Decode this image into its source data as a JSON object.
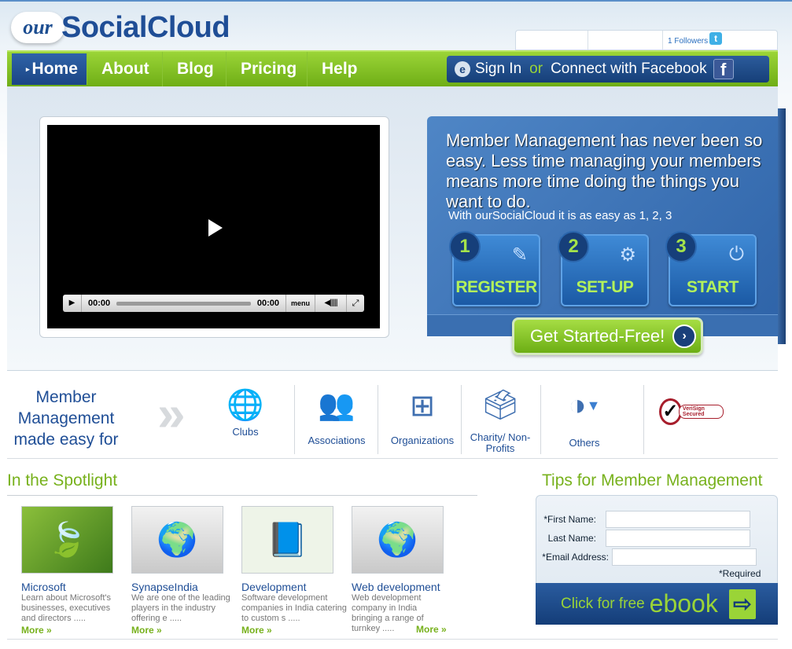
{
  "brand": {
    "logo_prefix": "our",
    "logo_name": "SocialCloud"
  },
  "twitter": {
    "followers": "1 Followers",
    "icon": "twitter-icon"
  },
  "nav": {
    "items": [
      {
        "label": "Home",
        "active": true
      },
      {
        "label": "About"
      },
      {
        "label": "Blog"
      },
      {
        "label": "Pricing"
      },
      {
        "label": "Help"
      }
    ]
  },
  "signin": {
    "sign_in": "Sign In",
    "or": "or",
    "connect": "Connect with Facebook",
    "fb_glyph": "f"
  },
  "video": {
    "time_current": "00:00",
    "time_total": "00:00",
    "menu": "menu"
  },
  "promo": {
    "headline": "Member Management has never been so easy. Less time managing your members means more time doing the things you want to do.",
    "sub": "With ourSocialCloud it is as easy as 1, 2, 3",
    "steps": [
      {
        "num": "1",
        "label": "REGISTER",
        "icon": "pen-icon"
      },
      {
        "num": "2",
        "label": "SET-UP",
        "icon": "gear-icon"
      },
      {
        "num": "3",
        "label": "START",
        "icon": "power-icon"
      }
    ]
  },
  "cta": {
    "label": "Get Started-Free!"
  },
  "member_made_easy": {
    "title": "Member Management made easy for",
    "categories": [
      {
        "label": "Clubs"
      },
      {
        "label": "Associations"
      },
      {
        "label": "Organizations"
      },
      {
        "label": "Charity/ Non-Profits"
      },
      {
        "label": "Others"
      }
    ]
  },
  "verisign": {
    "text": "VeriSign Secured"
  },
  "spotlight": {
    "title": "In the Spotlight",
    "items": [
      {
        "title": "Microsoft",
        "desc": "Learn about Microsoft's businesses, executives and directors .....",
        "more": "More »"
      },
      {
        "title": "SynapseIndia",
        "desc": "We are one of the leading players in the industry offering e .....",
        "more": "More »"
      },
      {
        "title": "Development",
        "desc": "Software development companies in India catering to custom s .....",
        "more": "More »"
      },
      {
        "title": "Web development",
        "desc": "Web development company in India bringing a range of turnkey .....",
        "more": "More »"
      }
    ]
  },
  "tips": {
    "title": "Tips for Member Management",
    "first_name": "*First Name:",
    "last_name": "Last Name:",
    "email": "*Email Address:",
    "required": "*Required",
    "ebook_small": "Click for free",
    "ebook_big": "ebook"
  }
}
